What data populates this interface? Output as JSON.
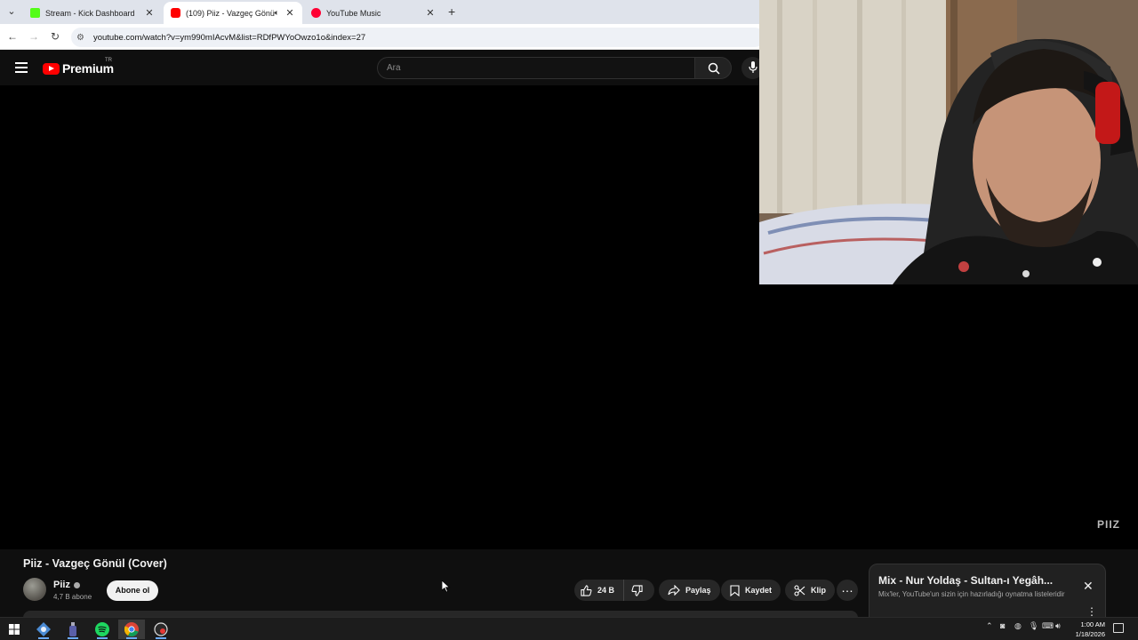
{
  "browser": {
    "tabs": [
      {
        "title": "Stream - Kick Dashboard",
        "favicon": "kick-icon",
        "active": false
      },
      {
        "title": "(109) Piiz - Vazgeç Gönül (C",
        "favicon": "youtube-icon",
        "active": true,
        "audio": true
      },
      {
        "title": "YouTube Music",
        "favicon": "youtube-music-icon",
        "active": false
      }
    ],
    "url": "youtube.com/watch?v=ym990mIAcvM&list=RDfPWYoOwzo1o&index=27"
  },
  "yt": {
    "logo_text": "Premium",
    "region": "TR",
    "search_placeholder": "Ara"
  },
  "video": {
    "title": "Piiz - Vazgeç Gönül (Cover)",
    "watermark": "PIIZ",
    "channel": "Piiz",
    "subscribers": "4,7 B abone",
    "subscribe_label": "Abone ol",
    "likes": "24 B",
    "share_label": "Paylaş",
    "save_label": "Kaydet",
    "clip_label": "Klip"
  },
  "mix": {
    "title": "Mix - Nur Yoldaş - Sultan-ı Yegâh...",
    "subtitle": "Mix'ler, YouTube'un sizin için hazırladığı oynatma listeleridir"
  },
  "taskbar": {
    "time": "1:00 AM",
    "date": "1/18/2026"
  },
  "colors": {
    "yt_red": "#ff0000",
    "background": "#0f0f0f",
    "kick_green": "#53fc18",
    "taskbar_accent": "#6aaaff"
  }
}
